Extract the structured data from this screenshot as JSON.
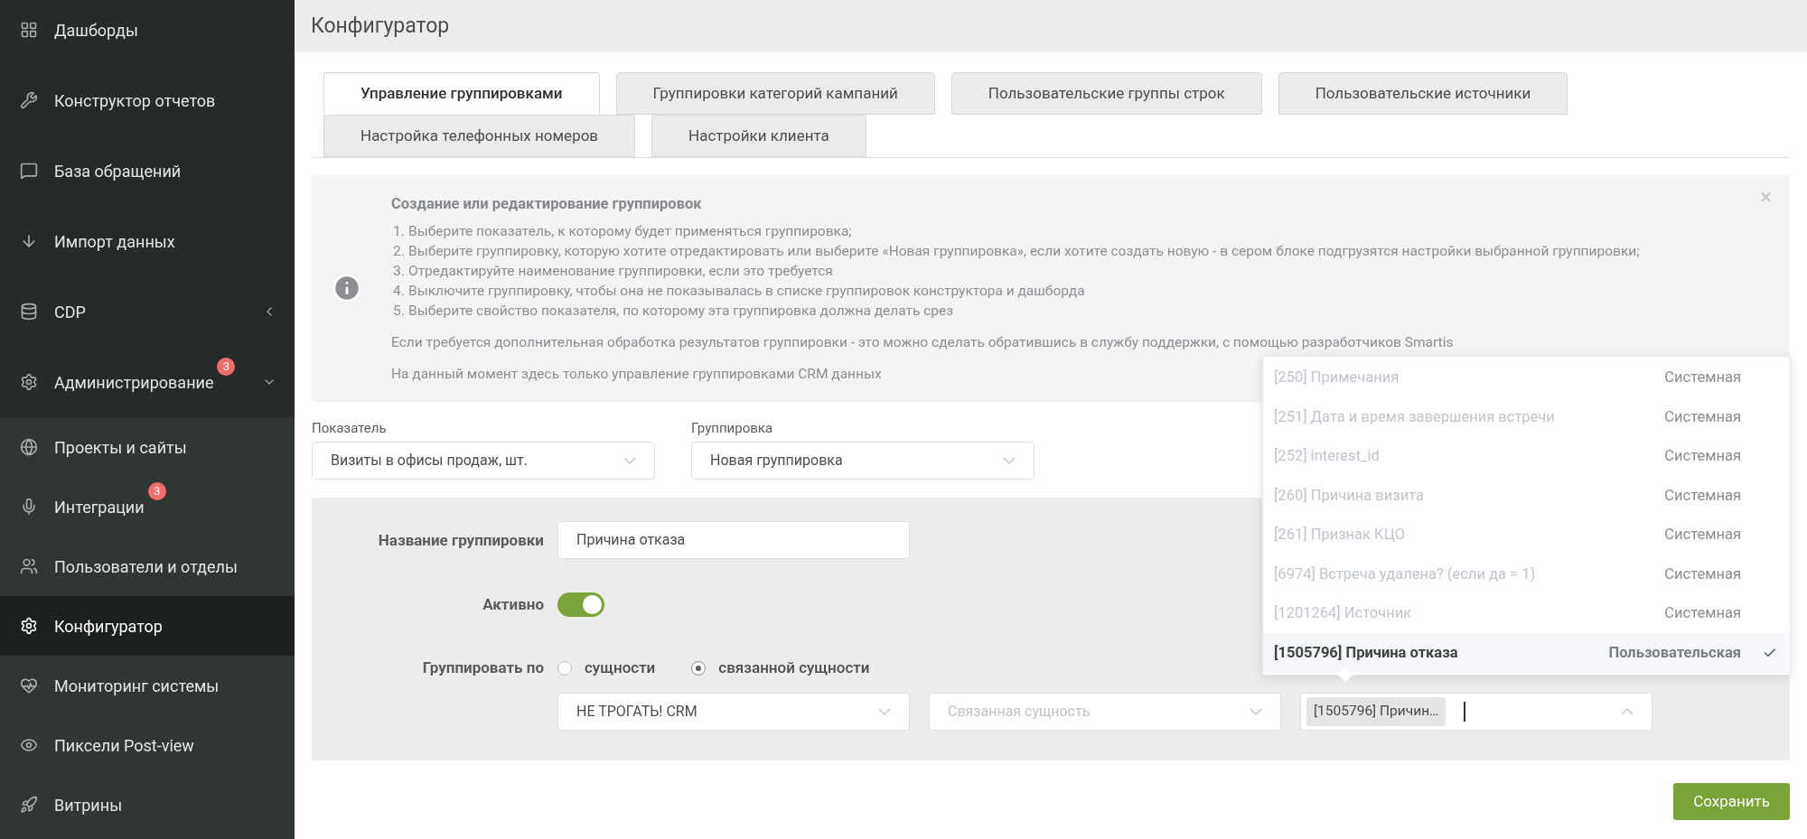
{
  "sidebar": {
    "items": [
      {
        "label": "Дашборды",
        "selected": false
      },
      {
        "label": "Конструктор отчетов",
        "selected": false
      },
      {
        "label": "База обращений",
        "selected": false
      },
      {
        "label": "Импорт данных",
        "selected": false
      },
      {
        "label": "CDP",
        "selected": false,
        "expanded": false
      },
      {
        "label": "Администрирование",
        "selected": false,
        "badge": "3",
        "expanded": true,
        "children": [
          {
            "label": "Проекты и сайты",
            "selected": false
          },
          {
            "label": "Интеграции",
            "selected": false,
            "badge": "3"
          },
          {
            "label": "Пользователи и отделы",
            "selected": false
          },
          {
            "label": "Конфигуратор",
            "selected": true
          },
          {
            "label": "Мониторинг системы",
            "selected": false
          },
          {
            "label": "Пиксели Post-view",
            "selected": false
          },
          {
            "label": "Витрины",
            "selected": false
          }
        ]
      }
    ]
  },
  "header": {
    "title": "Конфигуратор"
  },
  "tabs": [
    {
      "label": "Управление группировками",
      "selected": true
    },
    {
      "label": "Группировки категорий кампаний",
      "selected": false
    },
    {
      "label": "Пользовательские группы строк",
      "selected": false
    },
    {
      "label": "Пользовательские источники",
      "selected": false
    },
    {
      "label": "Настройка телефонных номеров",
      "selected": false
    },
    {
      "label": "Настройки клиента",
      "selected": false
    }
  ],
  "info": {
    "title": "Создание или редактирование группировок",
    "close": "×",
    "steps": [
      {
        "number": "1.",
        "text": "Выберите показатель, к которому будет применяться группировка;"
      },
      {
        "number": "2.",
        "text": "Выберите группировку, которую хотите отредактировать или выберите «Новая группировка», если хотите создать новую - в сером блоке подгрузятся настройки выбранной группировки;"
      },
      {
        "number": "3.",
        "text": "Отредактируйте наименование группировки, если это требуется"
      },
      {
        "number": "4.",
        "text": "Выключите группировку, чтобы она не показывалась в списке группировок конструктора и дашборда"
      },
      {
        "number": "5.",
        "text": "Выберите свойство показателя, по которому эта группировка должна делать срез"
      }
    ],
    "paragraphs": [
      "Если требуется дополнительная обработка результатов группировки - это можно сделать обратившись в службу поддержки, с помощью разработчиков Smartis",
      "На данный момент здесь только управление группировками CRM данных"
    ]
  },
  "filters": [
    {
      "label": "Показатель",
      "value": "Визиты в офисы продаж, шт."
    },
    {
      "label": "Группировка",
      "value": "Новая группировка"
    }
  ],
  "form": {
    "name_label": "Название группировки",
    "name_value": "Причина отказа",
    "active_label": "Активно",
    "active": {
      "on": true
    },
    "group_by_label": "Группировать по",
    "group_by_options": [
      {
        "label": "сущности",
        "selected": false
      },
      {
        "label": "связанной сущности",
        "selected": true
      }
    ],
    "entity_select": {
      "value": "НЕ ТРОГАТЬ! CRM"
    },
    "related_select": {
      "placeholder": "Связанная сущность"
    },
    "property_select": {
      "tag": "[1505796] Причин…",
      "expanded": true,
      "options": [
        {
          "label": "[250] Примечания",
          "type": "Системная",
          "disabled": true,
          "selected": false
        },
        {
          "label": "[251] Дата и время завершения встречи",
          "type": "Системная",
          "disabled": true,
          "selected": false
        },
        {
          "label": "[252] interest_id",
          "type": "Системная",
          "disabled": true,
          "selected": false
        },
        {
          "label": "[260] Причина визита",
          "type": "Системная",
          "disabled": true,
          "selected": false
        },
        {
          "label": "[261] Признак КЦО",
          "type": "Системная",
          "disabled": true,
          "selected": false
        },
        {
          "label": "[6974] Встреча удалена? (если да = 1)",
          "type": "Системная",
          "disabled": true,
          "selected": false
        },
        {
          "label": "[1201264] Источник",
          "type": "Системная",
          "disabled": true,
          "selected": false
        },
        {
          "label": "[1505796] Причина отказа",
          "type": "Пользовательская",
          "disabled": false,
          "selected": true
        }
      ]
    }
  },
  "save_button": "Сохранить"
}
